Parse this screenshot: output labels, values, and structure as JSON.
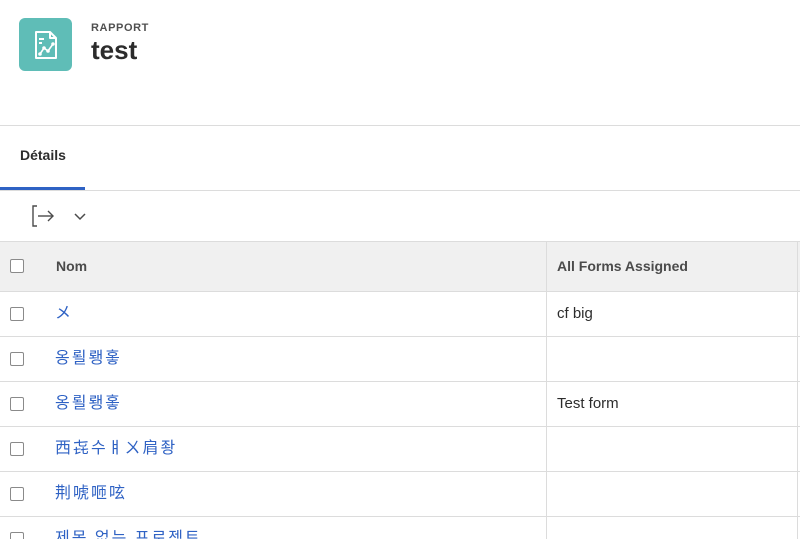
{
  "header": {
    "eyebrow": "RAPPORT",
    "title": "test",
    "icon": "report-chart-icon",
    "icon_color": "#5fbdb7"
  },
  "tabs": [
    {
      "label": "Détails",
      "active": true
    }
  ],
  "toolbar": {
    "export_icon": "export-icon",
    "more_icon": "chevron-down-icon"
  },
  "table": {
    "columns": [
      "Nom",
      "All Forms Assigned"
    ],
    "rows": [
      {
        "name": "メ",
        "forms": "cf big"
      },
      {
        "name": "옹뢸뢩홓",
        "forms": ""
      },
      {
        "name": "옹뢸뢩홓",
        "forms": "Test form"
      },
      {
        "name": "西㐂수ㅒㄨ肩좡",
        "forms": ""
      },
      {
        "name": "荆唬咂呟",
        "forms": ""
      },
      {
        "name": "제목 없는 프로젝트",
        "forms": ""
      }
    ]
  },
  "colors": {
    "accent": "#2f62c4",
    "header_bg": "#f0f0f0",
    "border": "#dcdcdc"
  }
}
